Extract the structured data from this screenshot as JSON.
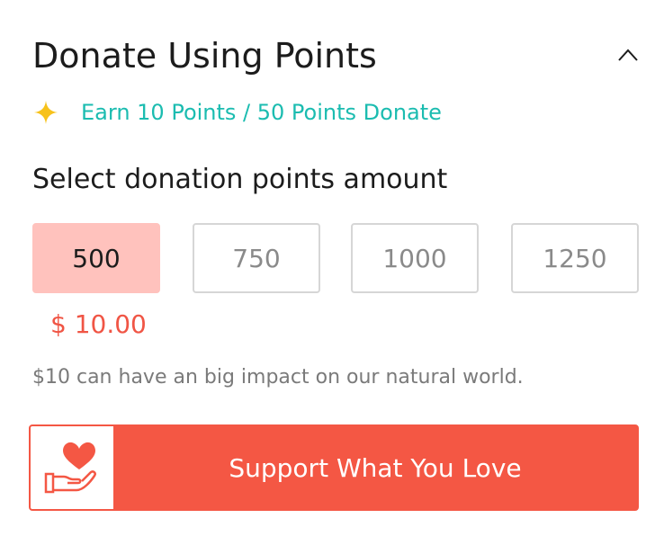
{
  "header": {
    "title": "Donate Using Points",
    "collapse_icon": "chevron-up-icon"
  },
  "earn": {
    "icon": "sparkle-icon",
    "text": "Earn 10 Points / 50 Points Donate",
    "color": "#1bbcb0"
  },
  "select": {
    "label": "Select donation points amount",
    "options": [
      "500",
      "750",
      "1000",
      "1250"
    ],
    "selected": "500"
  },
  "price": {
    "text": "$ 10.00"
  },
  "impact": {
    "text": "$10 can have an big impact on our natural world."
  },
  "support_button": {
    "label": "Support What You Love",
    "icon": "heart-hand-icon",
    "color": "#f45744"
  }
}
